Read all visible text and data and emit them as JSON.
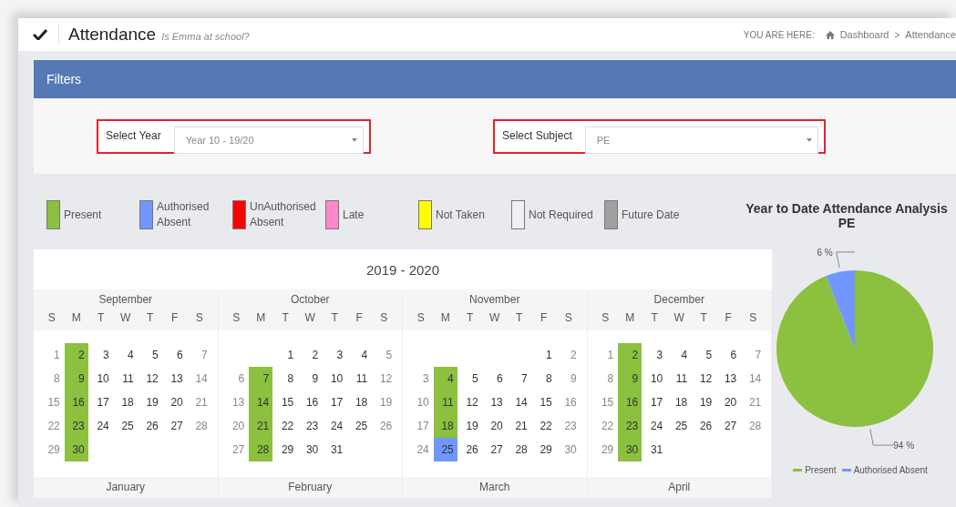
{
  "header": {
    "title": "Attendance",
    "subtitle": "Is Emma at school?",
    "breadcrumb": {
      "label": "YOU ARE HERE:",
      "items": [
        "Dashboard",
        "Attendance"
      ],
      "separator": ">"
    }
  },
  "filters": {
    "title": "Filters",
    "fields": [
      {
        "label": "Select Year",
        "value": "Year 10 - 19/20"
      },
      {
        "label": "Select Subject",
        "value": "PE"
      }
    ]
  },
  "legend": [
    {
      "label": "Present",
      "color": "#8cc03f"
    },
    {
      "label": "Authorised Absent",
      "color": "#7196ff"
    },
    {
      "label": "UnAuthorised Absent",
      "color": "#ff0000"
    },
    {
      "label": "Late",
      "color": "#ff88c8"
    },
    {
      "label": "Not Taken",
      "color": "#ffff00"
    },
    {
      "label": "Not Required",
      "color": "#f2f0f2"
    },
    {
      "label": "Future Date",
      "color": "#a0a0a0"
    }
  ],
  "calendar": {
    "title": "2019 - 2020",
    "months": [
      {
        "name": "September",
        "weekdays": [
          "S",
          "M",
          "T",
          "W",
          "T",
          "F",
          "S"
        ],
        "weeks": [
          [
            {
              "day": "1"
            },
            {
              "day": "2",
              "color": "#8cc03f"
            },
            {
              "day": "3"
            },
            {
              "day": "4"
            },
            {
              "day": "5"
            },
            {
              "day": "6"
            },
            {
              "day": "7"
            }
          ],
          [
            {
              "day": "8"
            },
            {
              "day": "9",
              "color": "#8cc03f"
            },
            {
              "day": "10"
            },
            {
              "day": "11"
            },
            {
              "day": "12"
            },
            {
              "day": "13"
            },
            {
              "day": "14"
            }
          ],
          [
            {
              "day": "15"
            },
            {
              "day": "16",
              "color": "#8cc03f"
            },
            {
              "day": "17"
            },
            {
              "day": "18"
            },
            {
              "day": "19"
            },
            {
              "day": "20"
            },
            {
              "day": "21"
            }
          ],
          [
            {
              "day": "22"
            },
            {
              "day": "23",
              "color": "#8cc03f"
            },
            {
              "day": "24"
            },
            {
              "day": "25"
            },
            {
              "day": "26"
            },
            {
              "day": "27"
            },
            {
              "day": "28"
            }
          ],
          [
            {
              "day": "29"
            },
            {
              "day": "30",
              "color": "#8cc03f"
            }
          ]
        ]
      },
      {
        "name": "October",
        "weekdays": [
          "S",
          "M",
          "T",
          "W",
          "T",
          "F",
          "S"
        ],
        "weeks": [
          [
            {
              "day": "1"
            },
            {
              "day": "2"
            },
            {
              "day": "3"
            },
            {
              "day": "4"
            },
            {
              "day": "5"
            }
          ],
          [
            {
              "day": "6"
            },
            {
              "day": "7",
              "color": "#8cc03f"
            },
            {
              "day": "8"
            },
            {
              "day": "9"
            },
            {
              "day": "10"
            },
            {
              "day": "11"
            },
            {
              "day": "12"
            }
          ],
          [
            {
              "day": "13"
            },
            {
              "day": "14",
              "color": "#8cc03f"
            },
            {
              "day": "15"
            },
            {
              "day": "16"
            },
            {
              "day": "17"
            },
            {
              "day": "18"
            },
            {
              "day": "19"
            }
          ],
          [
            {
              "day": "20"
            },
            {
              "day": "21",
              "color": "#8cc03f"
            },
            {
              "day": "22"
            },
            {
              "day": "23"
            },
            {
              "day": "24"
            },
            {
              "day": "25"
            },
            {
              "day": "26"
            }
          ],
          [
            {
              "day": "27"
            },
            {
              "day": "28",
              "color": "#8cc03f"
            },
            {
              "day": "29"
            },
            {
              "day": "30"
            },
            {
              "day": "31"
            }
          ]
        ]
      },
      {
        "name": "November",
        "weekdays": [
          "S",
          "M",
          "T",
          "W",
          "T",
          "F",
          "S"
        ],
        "weeks": [
          [
            {
              "day": "1"
            },
            {
              "day": "2"
            }
          ],
          [
            {
              "day": "3"
            },
            {
              "day": "4",
              "color": "#8cc03f"
            },
            {
              "day": "5"
            },
            {
              "day": "6"
            },
            {
              "day": "7"
            },
            {
              "day": "8"
            },
            {
              "day": "9"
            }
          ],
          [
            {
              "day": "10"
            },
            {
              "day": "11",
              "color": "#8cc03f"
            },
            {
              "day": "12"
            },
            {
              "day": "13"
            },
            {
              "day": "14"
            },
            {
              "day": "15"
            },
            {
              "day": "16"
            }
          ],
          [
            {
              "day": "17"
            },
            {
              "day": "18",
              "color": "#8cc03f"
            },
            {
              "day": "19"
            },
            {
              "day": "20"
            },
            {
              "day": "21"
            },
            {
              "day": "22"
            },
            {
              "day": "23"
            }
          ],
          [
            {
              "day": "24"
            },
            {
              "day": "25",
              "color": "#7196ff"
            },
            {
              "day": "26"
            },
            {
              "day": "27"
            },
            {
              "day": "28"
            },
            {
              "day": "29"
            },
            {
              "day": "30"
            }
          ]
        ]
      },
      {
        "name": "December",
        "weekdays": [
          "S",
          "M",
          "T",
          "W",
          "T",
          "F",
          "S"
        ],
        "weeks": [
          [
            {
              "day": "1"
            },
            {
              "day": "2",
              "color": "#8cc03f"
            },
            {
              "day": "3"
            },
            {
              "day": "4"
            },
            {
              "day": "5"
            },
            {
              "day": "6"
            },
            {
              "day": "7"
            }
          ],
          [
            {
              "day": "8"
            },
            {
              "day": "9",
              "color": "#8cc03f"
            },
            {
              "day": "10"
            },
            {
              "day": "11"
            },
            {
              "day": "12"
            },
            {
              "day": "13"
            },
            {
              "day": "14"
            }
          ],
          [
            {
              "day": "15"
            },
            {
              "day": "16",
              "color": "#8cc03f"
            },
            {
              "day": "17"
            },
            {
              "day": "18"
            },
            {
              "day": "19"
            },
            {
              "day": "20"
            },
            {
              "day": "21"
            }
          ],
          [
            {
              "day": "22"
            },
            {
              "day": "23",
              "color": "#8cc03f"
            },
            {
              "day": "24"
            },
            {
              "day": "25"
            },
            {
              "day": "26"
            },
            {
              "day": "27"
            },
            {
              "day": "28"
            }
          ],
          [
            {
              "day": "29"
            },
            {
              "day": "30",
              "color": "#8cc03f"
            },
            {
              "day": "31"
            }
          ]
        ]
      }
    ],
    "next_months": [
      "January",
      "February",
      "March",
      "April"
    ]
  },
  "chart": {
    "title": "Year to Date Attendance Analysis",
    "subtitle": "PE",
    "chart_data": {
      "type": "pie",
      "categories": [
        "Present",
        "Authorised Absent"
      ],
      "series": [
        {
          "values": [
            94,
            6
          ]
        }
      ],
      "colors": [
        "#8cc03f",
        "#7196ff"
      ],
      "value_labels": [
        "94 %",
        "6 %"
      ]
    }
  }
}
